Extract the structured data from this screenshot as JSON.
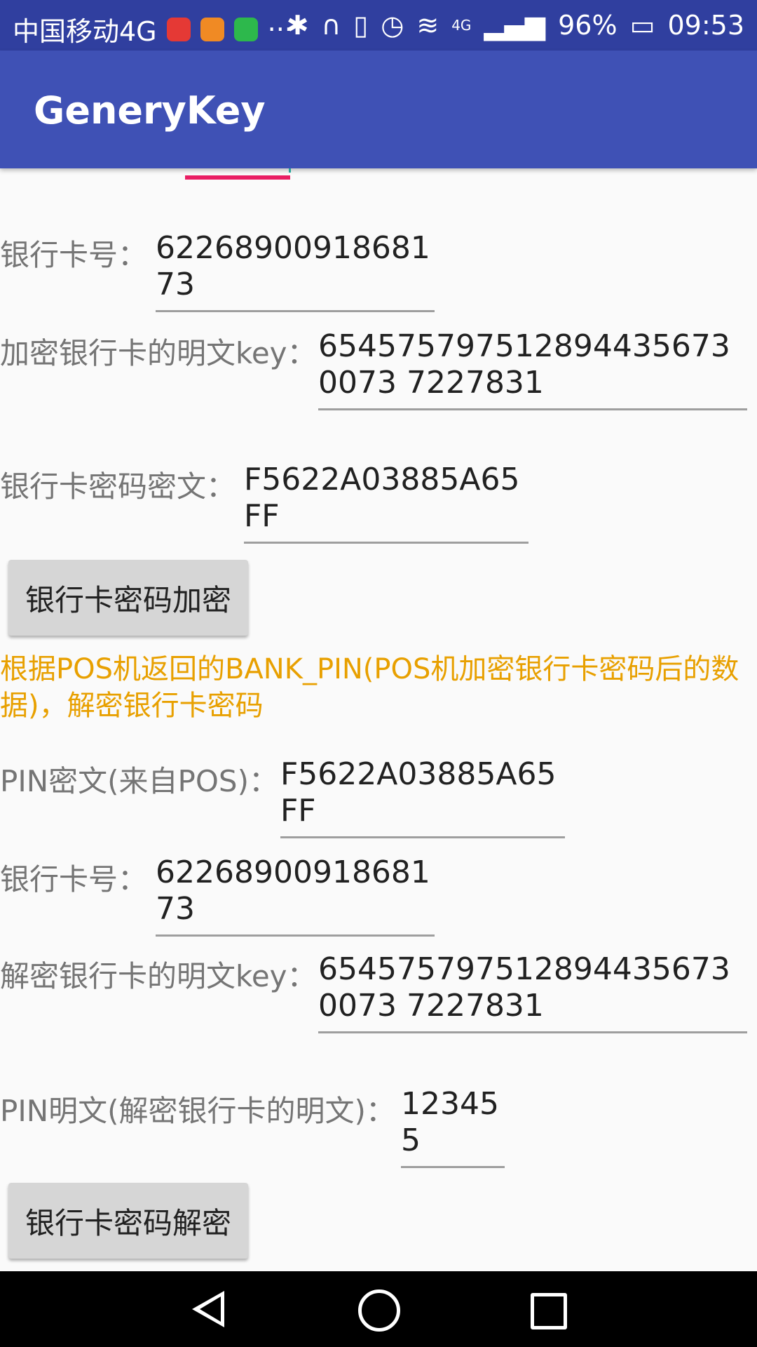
{
  "status": {
    "carrier": "中国移动4G",
    "dots": "···",
    "network": "4G",
    "battery": "96%",
    "time": "09:53"
  },
  "app": {
    "title": "GeneryKey"
  },
  "encrypt": {
    "card_label": "银行卡号：",
    "card_value": "6226890091868173",
    "key_label": "加密银行卡的明文key：",
    "key_value": "6545757975128944356730073 7227831",
    "cipher_label": "银行卡密码密文：",
    "cipher_value": "F5622A03885A65FF",
    "button": "银行卡密码加密"
  },
  "note": "根据POS机返回的BANK_PIN(POS机加密银行卡密码后的数据)，解密银行卡密码",
  "decrypt": {
    "pin_cipher_label": "PIN密文(来自POS)：",
    "pin_cipher_value": "F5622A03885A65FF",
    "card_label": "银行卡号：",
    "card_value": "6226890091868173",
    "key_label": "解密银行卡的明文key：",
    "key_value": "6545757975128944356730073 7227831",
    "pin_plain_label": "PIN明文(解密银行卡的明文)：",
    "pin_plain_value": "123455",
    "button": "银行卡密码解密"
  }
}
